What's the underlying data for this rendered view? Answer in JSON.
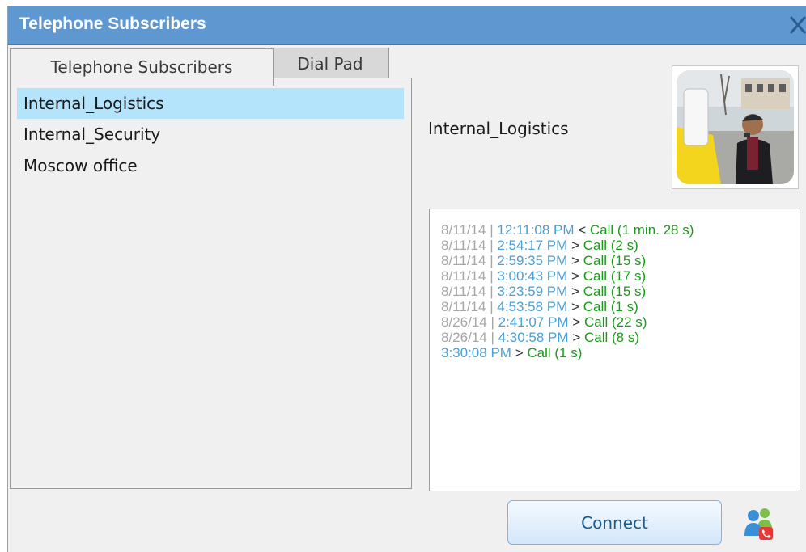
{
  "window": {
    "title": "Telephone Subscribers"
  },
  "tabs": [
    {
      "label": "Telephone Subscribers",
      "active": true
    },
    {
      "label": "Dial Pad",
      "active": false
    }
  ],
  "subscribers": [
    {
      "label": "Internal_Logistics",
      "selected": true
    },
    {
      "label": "Internal_Security",
      "selected": false
    },
    {
      "label": "Moscow office",
      "selected": false
    }
  ],
  "selected_subscriber": {
    "name": "Internal_Logistics",
    "avatar_icon": "user-photo"
  },
  "call_log": [
    {
      "date": "8/11/14",
      "time": "12:11:08 PM",
      "arrow": "<",
      "call": "Call (1 min. 28 s)"
    },
    {
      "date": "8/11/14",
      "time": "2:54:17 PM",
      "arrow": ">",
      "call": "Call (2 s)"
    },
    {
      "date": "8/11/14",
      "time": "2:59:35 PM",
      "arrow": ">",
      "call": "Call (15 s)"
    },
    {
      "date": "8/11/14",
      "time": "3:00:43 PM",
      "arrow": ">",
      "call": "Call (17 s)"
    },
    {
      "date": "8/11/14",
      "time": "3:23:59 PM",
      "arrow": ">",
      "call": "Call (15 s)"
    },
    {
      "date": "8/11/14",
      "time": "4:53:58 PM",
      "arrow": ">",
      "call": "Call (1 s)"
    },
    {
      "date": "8/26/14",
      "time": "2:41:07 PM",
      "arrow": ">",
      "call": "Call (22 s)"
    },
    {
      "date": "8/26/14",
      "time": "4:30:58 PM",
      "arrow": ">",
      "call": "Call (8 s)"
    },
    {
      "date": "",
      "time": "3:30:08 PM",
      "arrow": ">",
      "call": "Call (1 s)"
    }
  ],
  "log_separator": "|",
  "actions": {
    "connect_label": "Connect",
    "people_icon": "subscribers-call-icon"
  },
  "colors": {
    "titlebar": "#5f98d1",
    "selected_row": "#b3e4fb",
    "time": "#4aa0d8",
    "call": "#1a9b1a",
    "date": "#a6a6a6"
  }
}
